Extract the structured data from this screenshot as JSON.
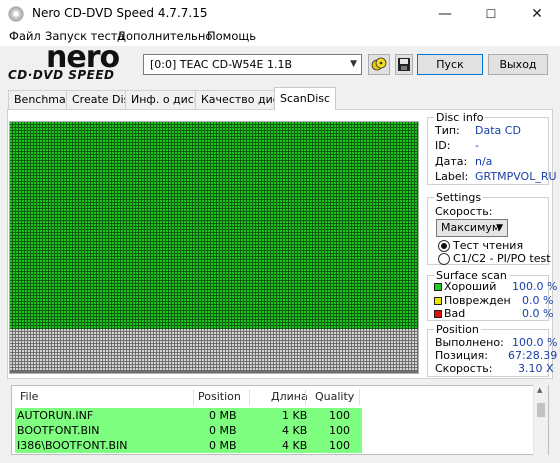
{
  "window": {
    "title": "Nero CD-DVD Speed 4.7.7.15",
    "controls": {
      "minimize": "—",
      "maximize": "☐",
      "close": "✕"
    }
  },
  "menu": [
    "Файл",
    "Запуск теста",
    "Дополнительно",
    "Помощь"
  ],
  "logo": {
    "brand": "nero",
    "sub": "CD·DVD SPEED"
  },
  "toolbar": {
    "drive": "[0:0]  TEAC CD-W54E 1.1B",
    "start_label": "Пуск",
    "exit_label": "Выход"
  },
  "tabs": [
    {
      "label": "Benchmark",
      "active": false
    },
    {
      "label": "Create Disc",
      "active": false
    },
    {
      "label": "Инф. о диске",
      "active": false
    },
    {
      "label": "Качество диска",
      "active": false
    },
    {
      "label": "ScanDisc",
      "active": true
    }
  ],
  "scan": {
    "good_fraction": 0.83,
    "good_color": "#1ec41e",
    "unscanned_color": "#d4d4d4"
  },
  "disc_info": {
    "title": "Disc info",
    "rows": [
      {
        "label": "Тип:",
        "value": "Data CD"
      },
      {
        "label": "ID:",
        "value": "-"
      },
      {
        "label": "Дата:",
        "value": "n/a"
      },
      {
        "label": "Label:",
        "value": "GRTMPVOL_RU"
      }
    ]
  },
  "settings": {
    "title": "Settings",
    "speed_label": "Скорость:",
    "speed_value": "Максимум",
    "radio_read": "Тест чтения",
    "radio_c1c2": "C1/C2 - PI/PO test"
  },
  "surface": {
    "title": "Surface scan",
    "rows": [
      {
        "label": "Хороший",
        "value": "100.0 %",
        "color": "#22cc22"
      },
      {
        "label": "Поврежден",
        "value": "0.0 %",
        "color": "#e8e800"
      },
      {
        "label": "Bad",
        "value": "0.0 %",
        "color": "#dd1111"
      }
    ]
  },
  "position": {
    "title": "Position",
    "rows": [
      {
        "label": "Выполнено:",
        "value": "100.0 %"
      },
      {
        "label": "Позиция:",
        "value": "67:28.39"
      },
      {
        "label": "Скорость:",
        "value": "3.10 X"
      }
    ]
  },
  "files": {
    "headers": {
      "file": "File",
      "position": "Position",
      "length": "Длина",
      "quality": "Quality"
    },
    "rows": [
      {
        "file": "AUTORUN.INF",
        "position": "0 MB",
        "length": "1 KB",
        "quality": "100"
      },
      {
        "file": "BOOTFONT.BIN",
        "position": "0 MB",
        "length": "4 KB",
        "quality": "100"
      },
      {
        "file": "I386\\BOOTFONT.BIN",
        "position": "0 MB",
        "length": "4 KB",
        "quality": "100"
      }
    ]
  }
}
